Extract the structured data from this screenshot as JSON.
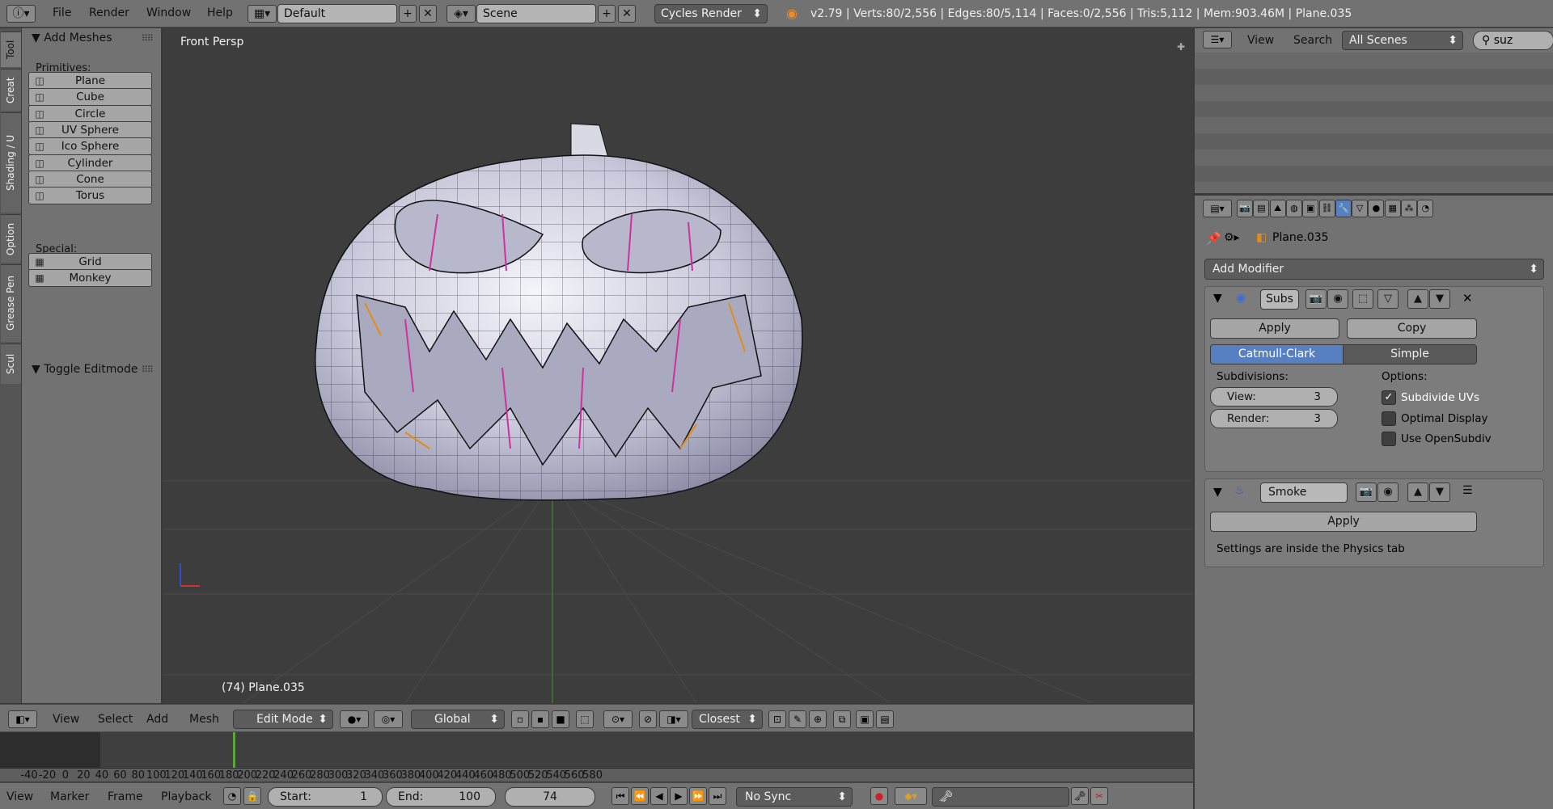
{
  "topbar": {
    "menus": [
      "File",
      "Render",
      "Window",
      "Help"
    ],
    "layout": "Default",
    "scene": "Scene",
    "engine": "Cycles Render",
    "stats": "v2.79 | Verts:80/2,556 | Edges:80/5,114 | Faces:0/2,556 | Tris:5,112 | Mem:903.46M | Plane.035"
  },
  "tabs": [
    "Tool",
    "Creat",
    "Shading / U",
    "Option",
    "Grease Pen",
    "Scul"
  ],
  "toolshelf": {
    "title": "Add Meshes",
    "primitives_label": "Primitives:",
    "primitives": [
      {
        "label": "Plane",
        "icon": "plane-icon"
      },
      {
        "label": "Cube",
        "icon": "cube-icon"
      },
      {
        "label": "Circle",
        "icon": "circle-icon"
      },
      {
        "label": "UV Sphere",
        "icon": "uv-sphere-icon"
      },
      {
        "label": "Ico Sphere",
        "icon": "ico-sphere-icon"
      },
      {
        "label": "Cylinder",
        "icon": "cylinder-icon"
      },
      {
        "label": "Cone",
        "icon": "cone-icon"
      },
      {
        "label": "Torus",
        "icon": "torus-icon"
      }
    ],
    "special_label": "Special:",
    "special": [
      {
        "label": "Grid",
        "icon": "grid-icon"
      },
      {
        "label": "Monkey",
        "icon": "monkey-icon"
      }
    ],
    "toggle_title": "Toggle Editmode"
  },
  "viewport": {
    "view_name": "Front Persp",
    "object_label": "(74) Plane.035"
  },
  "header3d": {
    "menus": [
      "View",
      "Select",
      "Add",
      "Mesh"
    ],
    "mode": "Edit Mode",
    "orientation": "Global",
    "snap": "Closest"
  },
  "timeline": {
    "ticks": [
      "-40",
      "-20",
      "0",
      "20",
      "40",
      "60",
      "80",
      "100",
      "120",
      "140",
      "160",
      "180",
      "200",
      "220",
      "240",
      "260",
      "280",
      "300",
      "320",
      "340",
      "360",
      "380",
      "400",
      "420",
      "440",
      "460",
      "480",
      "500",
      "520",
      "540",
      "560",
      "580"
    ],
    "current_frame_marker": 74
  },
  "playbar": {
    "menus": [
      "View",
      "Marker",
      "Frame",
      "Playback"
    ],
    "start_label": "Start:",
    "start_value": "1",
    "end_label": "End:",
    "end_value": "100",
    "current_frame": "74",
    "sync": "No Sync"
  },
  "outliner": {
    "menus": [
      "View",
      "Search"
    ],
    "scope": "All Scenes",
    "search_value": "suz"
  },
  "properties": {
    "object_name": "Plane.035",
    "add_modifier": "Add Modifier",
    "subsurf": {
      "name": "Subs",
      "apply": "Apply",
      "copy": "Copy",
      "tab_catmull": "Catmull-Clark",
      "tab_simple": "Simple",
      "subdivisions_label": "Subdivisions:",
      "view_label": "View:",
      "view_value": "3",
      "render_label": "Render:",
      "render_value": "3",
      "options_label": "Options:",
      "opt_subdivide_uvs": "Subdivide UVs",
      "opt_optimal_display": "Optimal Display",
      "opt_opensubdiv": "Use OpenSubdiv"
    },
    "smoke": {
      "name": "Smoke",
      "apply": "Apply",
      "note": "Settings are inside the Physics tab"
    }
  },
  "colors": {
    "active_tab": "#5680c2",
    "header_gray": "#727272",
    "viewport_bg": "#3d3d3d",
    "mesh_wire": "#111111",
    "seam": "#d030a0",
    "selected_edges": "#e88a10",
    "frame_marker": "#5aa83a"
  }
}
